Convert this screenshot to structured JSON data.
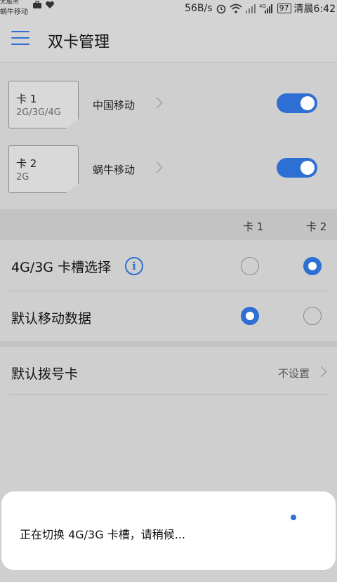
{
  "status_bar": {
    "operator_top": "无服务",
    "operator_bottom": "蜗牛移动",
    "speed": "56B/s",
    "battery": "97",
    "time": "清晨6:42",
    "icons": [
      "briefcase-icon",
      "heart-icon",
      "alarm-icon",
      "wifi-icon",
      "signal-icon",
      "signal-4g-icon"
    ]
  },
  "toolbar": {
    "menu_icon": "menu-icon",
    "title": "双卡管理"
  },
  "sim_cards": [
    {
      "card": "卡 1",
      "network": "2G/3G/4G",
      "carrier": "中国移动",
      "enabled": true
    },
    {
      "card": "卡 2",
      "network": "2G",
      "carrier": "蜗牛移动",
      "enabled": true
    }
  ],
  "columns": {
    "card1": "卡 1",
    "card2": "卡 2"
  },
  "options": [
    {
      "label": "4G/3G 卡槽选择",
      "info_icon": "i",
      "selected": "card2"
    },
    {
      "label": "默认移动数据",
      "selected": "card1"
    }
  ],
  "default_dial": {
    "label": "默认拨号卡",
    "value": "不设置"
  },
  "dialog": {
    "message": "正在切换 4G/3G 卡槽，请稍候..."
  },
  "colors": {
    "accent": "#2d6fd3",
    "background": "#cfcfcf",
    "dialog_bg": "#ffffff"
  }
}
